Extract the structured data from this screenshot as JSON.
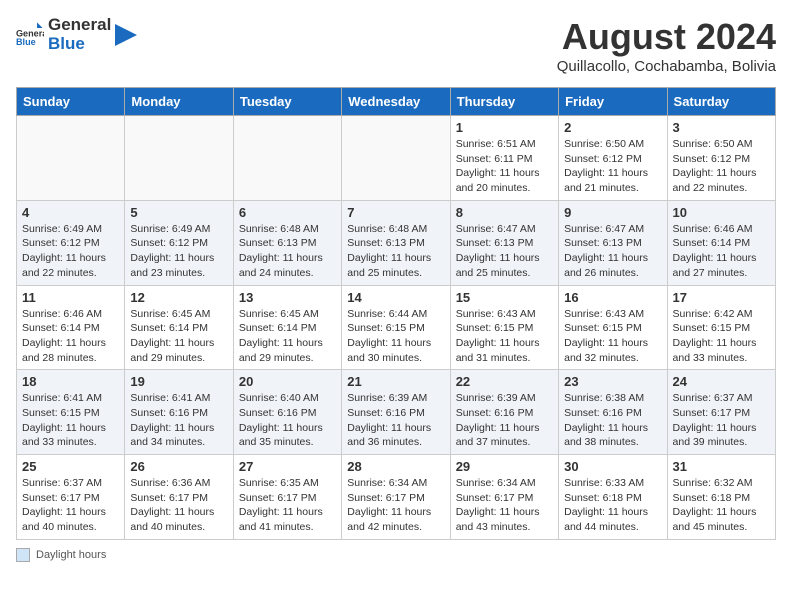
{
  "header": {
    "logo_general": "General",
    "logo_blue": "Blue",
    "month_title": "August 2024",
    "subtitle": "Quillacollo, Cochabamba, Bolivia"
  },
  "days_of_week": [
    "Sunday",
    "Monday",
    "Tuesday",
    "Wednesday",
    "Thursday",
    "Friday",
    "Saturday"
  ],
  "weeks": [
    [
      {
        "day": "",
        "info": ""
      },
      {
        "day": "",
        "info": ""
      },
      {
        "day": "",
        "info": ""
      },
      {
        "day": "",
        "info": ""
      },
      {
        "day": "1",
        "info": "Sunrise: 6:51 AM\nSunset: 6:11 PM\nDaylight: 11 hours and 20 minutes."
      },
      {
        "day": "2",
        "info": "Sunrise: 6:50 AM\nSunset: 6:12 PM\nDaylight: 11 hours and 21 minutes."
      },
      {
        "day": "3",
        "info": "Sunrise: 6:50 AM\nSunset: 6:12 PM\nDaylight: 11 hours and 22 minutes."
      }
    ],
    [
      {
        "day": "4",
        "info": "Sunrise: 6:49 AM\nSunset: 6:12 PM\nDaylight: 11 hours and 22 minutes."
      },
      {
        "day": "5",
        "info": "Sunrise: 6:49 AM\nSunset: 6:12 PM\nDaylight: 11 hours and 23 minutes."
      },
      {
        "day": "6",
        "info": "Sunrise: 6:48 AM\nSunset: 6:13 PM\nDaylight: 11 hours and 24 minutes."
      },
      {
        "day": "7",
        "info": "Sunrise: 6:48 AM\nSunset: 6:13 PM\nDaylight: 11 hours and 25 minutes."
      },
      {
        "day": "8",
        "info": "Sunrise: 6:47 AM\nSunset: 6:13 PM\nDaylight: 11 hours and 25 minutes."
      },
      {
        "day": "9",
        "info": "Sunrise: 6:47 AM\nSunset: 6:13 PM\nDaylight: 11 hours and 26 minutes."
      },
      {
        "day": "10",
        "info": "Sunrise: 6:46 AM\nSunset: 6:14 PM\nDaylight: 11 hours and 27 minutes."
      }
    ],
    [
      {
        "day": "11",
        "info": "Sunrise: 6:46 AM\nSunset: 6:14 PM\nDaylight: 11 hours and 28 minutes."
      },
      {
        "day": "12",
        "info": "Sunrise: 6:45 AM\nSunset: 6:14 PM\nDaylight: 11 hours and 29 minutes."
      },
      {
        "day": "13",
        "info": "Sunrise: 6:45 AM\nSunset: 6:14 PM\nDaylight: 11 hours and 29 minutes."
      },
      {
        "day": "14",
        "info": "Sunrise: 6:44 AM\nSunset: 6:15 PM\nDaylight: 11 hours and 30 minutes."
      },
      {
        "day": "15",
        "info": "Sunrise: 6:43 AM\nSunset: 6:15 PM\nDaylight: 11 hours and 31 minutes."
      },
      {
        "day": "16",
        "info": "Sunrise: 6:43 AM\nSunset: 6:15 PM\nDaylight: 11 hours and 32 minutes."
      },
      {
        "day": "17",
        "info": "Sunrise: 6:42 AM\nSunset: 6:15 PM\nDaylight: 11 hours and 33 minutes."
      }
    ],
    [
      {
        "day": "18",
        "info": "Sunrise: 6:41 AM\nSunset: 6:15 PM\nDaylight: 11 hours and 33 minutes."
      },
      {
        "day": "19",
        "info": "Sunrise: 6:41 AM\nSunset: 6:16 PM\nDaylight: 11 hours and 34 minutes."
      },
      {
        "day": "20",
        "info": "Sunrise: 6:40 AM\nSunset: 6:16 PM\nDaylight: 11 hours and 35 minutes."
      },
      {
        "day": "21",
        "info": "Sunrise: 6:39 AM\nSunset: 6:16 PM\nDaylight: 11 hours and 36 minutes."
      },
      {
        "day": "22",
        "info": "Sunrise: 6:39 AM\nSunset: 6:16 PM\nDaylight: 11 hours and 37 minutes."
      },
      {
        "day": "23",
        "info": "Sunrise: 6:38 AM\nSunset: 6:16 PM\nDaylight: 11 hours and 38 minutes."
      },
      {
        "day": "24",
        "info": "Sunrise: 6:37 AM\nSunset: 6:17 PM\nDaylight: 11 hours and 39 minutes."
      }
    ],
    [
      {
        "day": "25",
        "info": "Sunrise: 6:37 AM\nSunset: 6:17 PM\nDaylight: 11 hours and 40 minutes."
      },
      {
        "day": "26",
        "info": "Sunrise: 6:36 AM\nSunset: 6:17 PM\nDaylight: 11 hours and 40 minutes."
      },
      {
        "day": "27",
        "info": "Sunrise: 6:35 AM\nSunset: 6:17 PM\nDaylight: 11 hours and 41 minutes."
      },
      {
        "day": "28",
        "info": "Sunrise: 6:34 AM\nSunset: 6:17 PM\nDaylight: 11 hours and 42 minutes."
      },
      {
        "day": "29",
        "info": "Sunrise: 6:34 AM\nSunset: 6:17 PM\nDaylight: 11 hours and 43 minutes."
      },
      {
        "day": "30",
        "info": "Sunrise: 6:33 AM\nSunset: 6:18 PM\nDaylight: 11 hours and 44 minutes."
      },
      {
        "day": "31",
        "info": "Sunrise: 6:32 AM\nSunset: 6:18 PM\nDaylight: 11 hours and 45 minutes."
      }
    ]
  ],
  "footer": {
    "daylight_label": "Daylight hours"
  }
}
